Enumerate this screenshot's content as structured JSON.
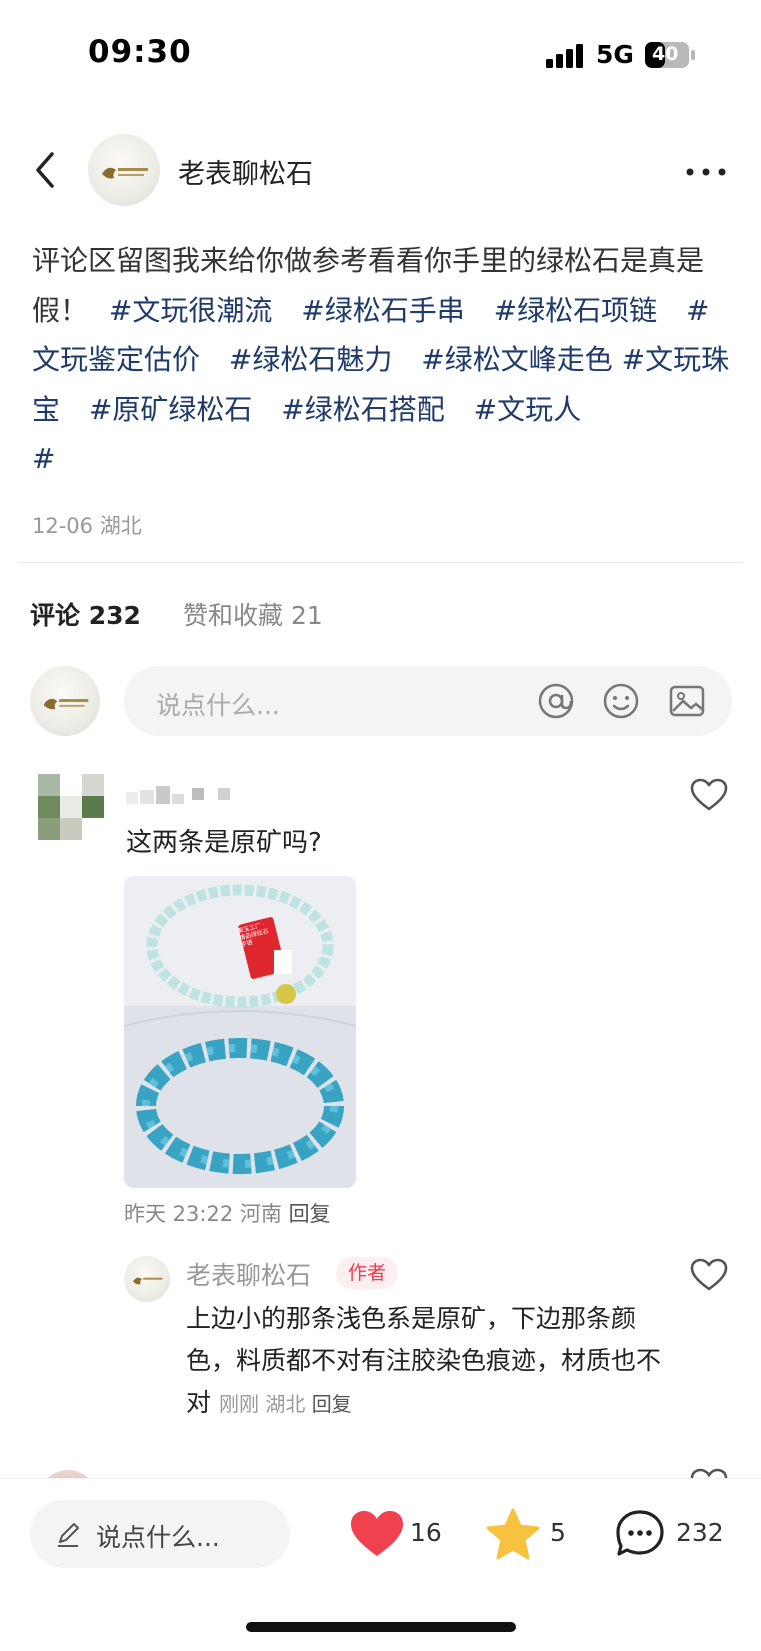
{
  "status_bar": {
    "time": "09:30",
    "network": "5G",
    "battery": "40"
  },
  "header": {
    "author_name": "老表聊松石"
  },
  "post": {
    "text": "评论区留图我来给你做参考看看你手里的绿松石是真是假！",
    "tags": [
      "#文玩很潮流",
      "#绿松石手串",
      "#绿松石项链",
      "#文玩鉴定估价",
      "#绿松石魅力",
      "#绿松文峰走色",
      "#文玩珠宝",
      "#原矿绿松石",
      "#绿松石搭配",
      "#文玩人"
    ],
    "trailing_tag": "#",
    "meta": "12-06 湖北"
  },
  "tabs": {
    "comments_label": "评论",
    "comments_count": "232",
    "likes_label": "赞和收藏",
    "likes_count": "21"
  },
  "comment_input": {
    "placeholder": "说点什么..."
  },
  "comments": [
    {
      "text": "这两条是原矿吗?",
      "time": "昨天 23:22",
      "location": "河南",
      "reply_label": "回复",
      "photo_tag_text": "聚玉工厂 · 精品绿松石 手链",
      "replies": [
        {
          "author": "老表聊松石",
          "badge": "作者",
          "text": "上边小的那条浅色系是原矿，下边那条颜色，料质都不对有注胶染色痕迹，材质也不对",
          "time": "刚刚",
          "location": "湖北",
          "reply_label": "回复"
        }
      ]
    }
  ],
  "bottom_bar": {
    "input_placeholder": "说点什么...",
    "likes": "16",
    "stars": "5",
    "comments": "232"
  },
  "colors": {
    "tag": "#1f3a6b",
    "like_red": "#f0414f",
    "star_yellow": "#f7c23f",
    "badge_red": "#f03c4c"
  }
}
